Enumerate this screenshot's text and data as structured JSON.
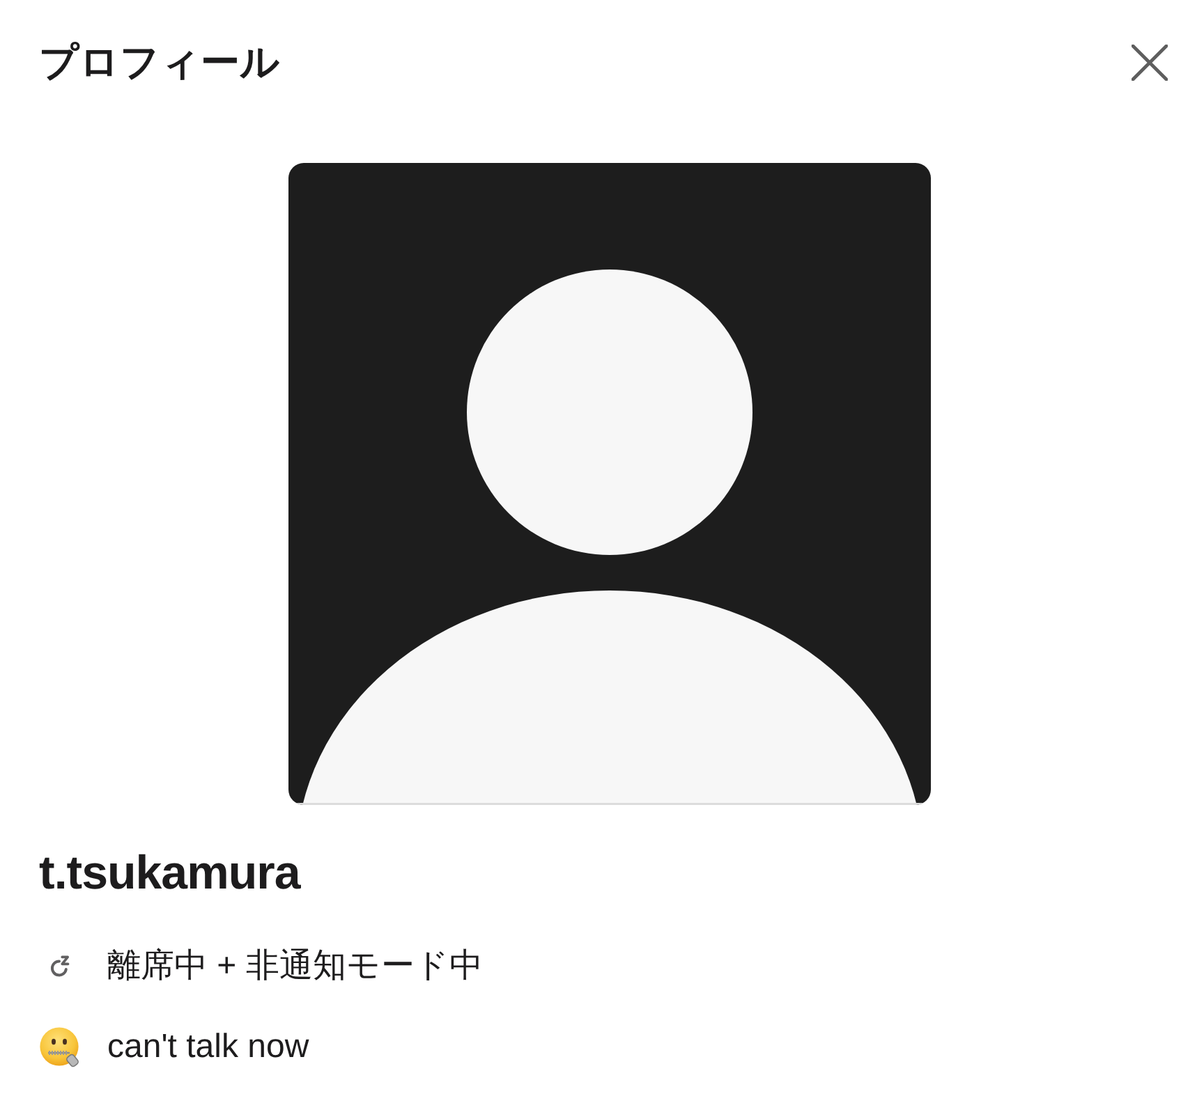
{
  "title": "プロフィール",
  "profile": {
    "display_name": "t.tsukamura",
    "status_lines": [
      {
        "kind": "presence",
        "text": "離席中 + 非通知モード中"
      },
      {
        "kind": "custom_status",
        "text": "can't talk now"
      }
    ]
  }
}
